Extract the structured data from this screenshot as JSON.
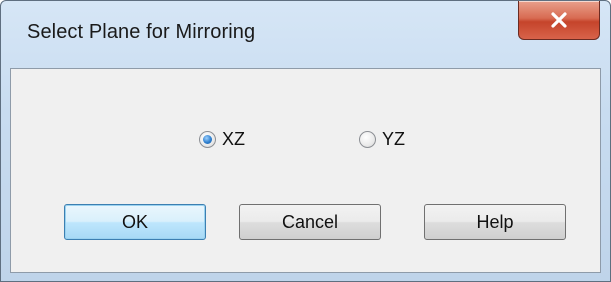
{
  "dialog": {
    "title": "Select Plane for Mirroring",
    "close_icon": "close-icon",
    "close_color": "#c5442b"
  },
  "plane_options": [
    {
      "label": "XZ",
      "checked": true
    },
    {
      "label": "YZ",
      "checked": false
    }
  ],
  "buttons": {
    "ok_label": "OK",
    "cancel_label": "Cancel",
    "help_label": "Help"
  }
}
